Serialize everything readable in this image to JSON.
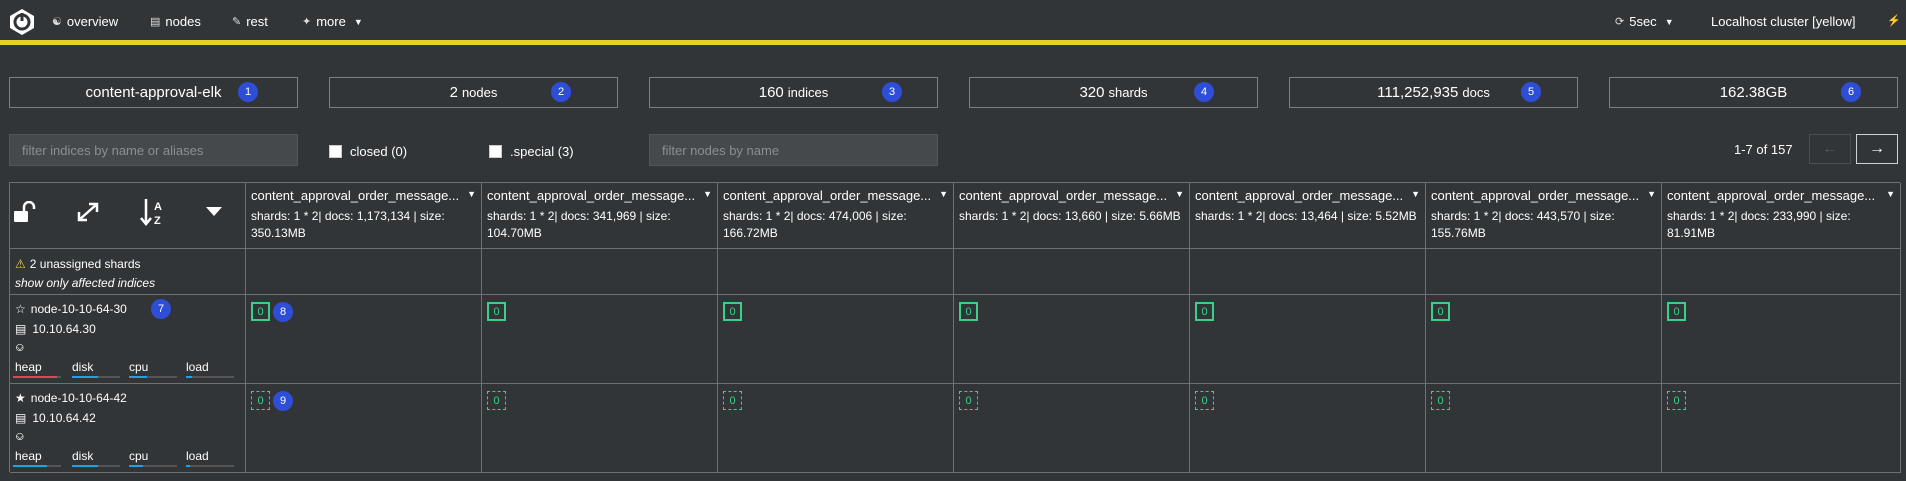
{
  "nav": {
    "overview": "overview",
    "nodes": "nodes",
    "rest": "rest",
    "more": "more",
    "refresh": "5sec",
    "cluster": "Localhost cluster [yellow]"
  },
  "stats": {
    "cluster_name": "content-approval-elk",
    "nodes_count": "2",
    "nodes_unit": "nodes",
    "indices_count": "160",
    "indices_unit": "indices",
    "shards_count": "320",
    "shards_unit": "shards",
    "docs_count": "111,252,935",
    "docs_unit": "docs",
    "size": "162.38GB"
  },
  "badges": [
    "1",
    "2",
    "3",
    "4",
    "5",
    "6",
    "7",
    "8",
    "9"
  ],
  "filters": {
    "indices_placeholder": "filter indices by name or aliases",
    "closed_label": "closed (0)",
    "special_label": ".special (3)",
    "nodes_placeholder": "filter nodes by name"
  },
  "pager": {
    "text": "1-7 of 157",
    "prev": "←",
    "next": "→"
  },
  "indices": [
    {
      "name": "content_approval_order_message...",
      "info": "shards: 1 * 2| docs: 1,173,134 | size: 350.13MB"
    },
    {
      "name": "content_approval_order_message...",
      "info": "shards: 1 * 2| docs: 341,969 | size: 104.70MB"
    },
    {
      "name": "content_approval_order_message...",
      "info": "shards: 1 * 2| docs: 474,006 | size: 166.72MB"
    },
    {
      "name": "content_approval_order_message...",
      "info": "shards: 1 * 2| docs: 13,660 | size: 5.66MB"
    },
    {
      "name": "content_approval_order_message...",
      "info": "shards: 1 * 2| docs: 13,464 | size: 5.52MB"
    },
    {
      "name": "content_approval_order_message...",
      "info": "shards: 1 * 2| docs: 443,570 | size: 155.76MB"
    },
    {
      "name": "content_approval_order_message...",
      "info": "shards: 1 * 2| docs: 233,990 | size: 81.91MB"
    }
  ],
  "unassigned": {
    "text": "2 unassigned shards",
    "filter": "show only affected indices"
  },
  "nodes": [
    {
      "name": "node-10-10-64-30",
      "ip": "10.10.64.30",
      "master": false,
      "shard": "0"
    },
    {
      "name": "node-10-10-64-42",
      "ip": "10.10.64.42",
      "master": true,
      "shard": "0"
    }
  ],
  "metrics": {
    "heap": "heap",
    "disk": "disk",
    "cpu": "cpu",
    "load": "load"
  },
  "colors": {
    "accent": "#e4d226",
    "badge": "#2f4ed8",
    "shard": "#3ad08a",
    "heap_high": "#e0455a",
    "metric_ok": "#1ea1e8"
  }
}
